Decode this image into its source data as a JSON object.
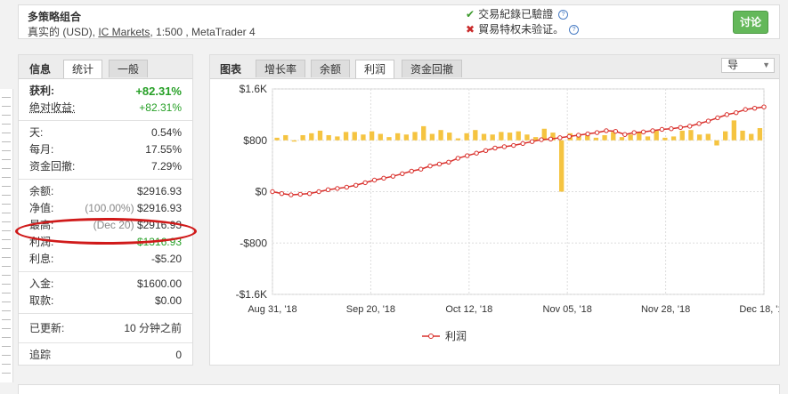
{
  "header": {
    "title": "多策略组合",
    "sub_prefix": "真实的 (USD), ",
    "broker": "IC Markets",
    "sub_suffix": ", 1:500 , MetaTrader 4",
    "verified_label": "交易紀錄已驗證",
    "unverified_label": "貿易特权未验证。",
    "question_mark": "?",
    "discuss_button": "讨论"
  },
  "info_panel": {
    "tabs": [
      {
        "label": "信息",
        "active": false
      },
      {
        "label": "统计",
        "active": true
      },
      {
        "label": "一般",
        "active": false
      }
    ],
    "stats": {
      "gain": {
        "label": "获利:",
        "value": "+82.31%"
      },
      "abs_gain": {
        "label": "绝对收益:",
        "value": "+82.31%"
      },
      "daily": {
        "label": "天:",
        "value": "0.54%"
      },
      "monthly": {
        "label": "每月:",
        "value": "17.55%"
      },
      "drawdown": {
        "label": "资金回撤:",
        "value": "7.29%"
      },
      "balance": {
        "label": "余额:",
        "value": "$2916.93"
      },
      "equity": {
        "label": "净值:",
        "value_prefix": "(100.00%)",
        "value": "$2916.93"
      },
      "highest": {
        "label": "最高:",
        "value_prefix": "(Dec 20)",
        "value": "$2916.93"
      },
      "profit": {
        "label": "利润:",
        "value": "$1316.93"
      },
      "interest": {
        "label": "利息:",
        "value": "-$5.20"
      },
      "deposits": {
        "label": "入金:",
        "value": "$1600.00"
      },
      "withdrawals": {
        "label": "取款:",
        "value": "$0.00"
      },
      "updated": {
        "label": "已更新:",
        "value": "10 分钟之前"
      },
      "tracking": {
        "label": "追踪",
        "value": "0"
      }
    }
  },
  "chart_panel": {
    "tabs": [
      {
        "label": "图表",
        "active": false
      },
      {
        "label": "增长率",
        "active": false
      },
      {
        "label": "余额",
        "active": false
      },
      {
        "label": "利润",
        "active": true
      },
      {
        "label": "资金回撤",
        "active": false
      }
    ],
    "period_select": "导",
    "colors": {
      "line": "#d9302c",
      "bars": "#f5c441",
      "grid": "#dddddd"
    }
  },
  "chart_data": {
    "type": "line",
    "title": "",
    "ylabel": "",
    "ylim": [
      -1600,
      1600
    ],
    "y_ticks": [
      "$1.6K",
      "$800",
      "$0",
      "-$800",
      "-$1.6K"
    ],
    "y_tick_values": [
      1600,
      800,
      0,
      -800,
      -1600
    ],
    "x_ticks": [
      "Aug 31, '18",
      "Sep 20, '18",
      "Oct 12, '18",
      "Nov 05, '18",
      "Nov 28, '18",
      "Dec 18, '18"
    ],
    "legend": "利润",
    "series": [
      {
        "name": "利润",
        "type": "line",
        "values": [
          0,
          -30,
          -50,
          -40,
          -30,
          0,
          30,
          50,
          70,
          100,
          140,
          180,
          210,
          240,
          280,
          320,
          350,
          400,
          430,
          460,
          520,
          560,
          600,
          640,
          680,
          700,
          720,
          750,
          780,
          810,
          820,
          840,
          860,
          880,
          900,
          920,
          950,
          940,
          890,
          920,
          930,
          950,
          970,
          980,
          1000,
          1020,
          1060,
          1100,
          1150,
          1200,
          1230,
          1280,
          1300,
          1320
        ]
      },
      {
        "name": "daily",
        "type": "bar",
        "values": [
          40,
          80,
          -20,
          80,
          110,
          150,
          80,
          60,
          130,
          130,
          90,
          140,
          100,
          50,
          110,
          90,
          130,
          220,
          100,
          160,
          120,
          30,
          110,
          160,
          100,
          90,
          130,
          120,
          140,
          90,
          50,
          180,
          120,
          -800,
          110,
          100,
          80,
          40,
          80,
          130,
          50,
          90,
          130,
          60,
          150,
          40,
          60,
          150,
          160,
          90,
          100,
          -80,
          140,
          310,
          150,
          100,
          190
        ]
      }
    ]
  },
  "legend_label": "利润"
}
